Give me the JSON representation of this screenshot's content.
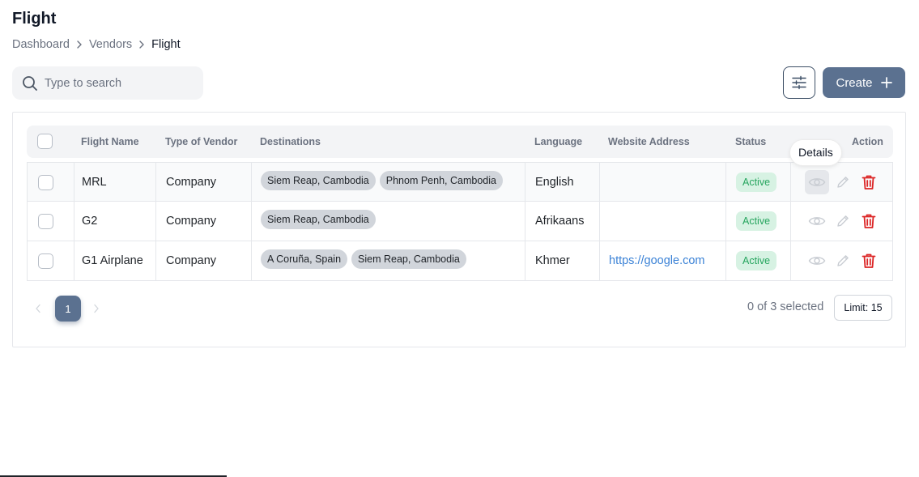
{
  "page": {
    "title": "Flight"
  },
  "breadcrumb": {
    "items": [
      "Dashboard",
      "Vendors",
      "Flight"
    ]
  },
  "search": {
    "placeholder": "Type to search",
    "value": ""
  },
  "toolbar": {
    "filter_icon": "sliders-icon",
    "create_label": "Create",
    "create_icon": "plus-icon"
  },
  "table": {
    "headers": {
      "flight_name": "Flight Name",
      "type_of_vendor": "Type of Vendor",
      "destinations": "Destinations",
      "language": "Language",
      "website": "Website Address",
      "status": "Status",
      "action": "Action"
    },
    "rows": [
      {
        "name": "MRL",
        "type": "Company",
        "destinations": [
          "Siem Reap, Cambodia",
          "Phnom Penh, Cambodia"
        ],
        "language": "English",
        "website": "",
        "status": "Active"
      },
      {
        "name": "G2",
        "type": "Company",
        "destinations": [
          "Siem Reap, Cambodia"
        ],
        "language": "Afrikaans",
        "website": "",
        "status": "Active"
      },
      {
        "name": "G1 Airplane",
        "type": "Company",
        "destinations": [
          "A Coruña, Spain",
          "Siem Reap, Cambodia"
        ],
        "language": "Khmer",
        "website": "https://google.com",
        "status": "Active"
      }
    ],
    "action_icons": [
      "eye-icon",
      "pencil-icon",
      "trash-icon"
    ],
    "tooltip": "Details"
  },
  "pagination": {
    "current_page": "1",
    "selected_text": "0 of 3 selected",
    "limit_label": "Limit: 15"
  },
  "colors": {
    "primary": "#5b7190",
    "danger": "#dc2626",
    "status_bg": "#d7f2e3",
    "status_text": "#26a55e",
    "link": "#3b82d6"
  }
}
